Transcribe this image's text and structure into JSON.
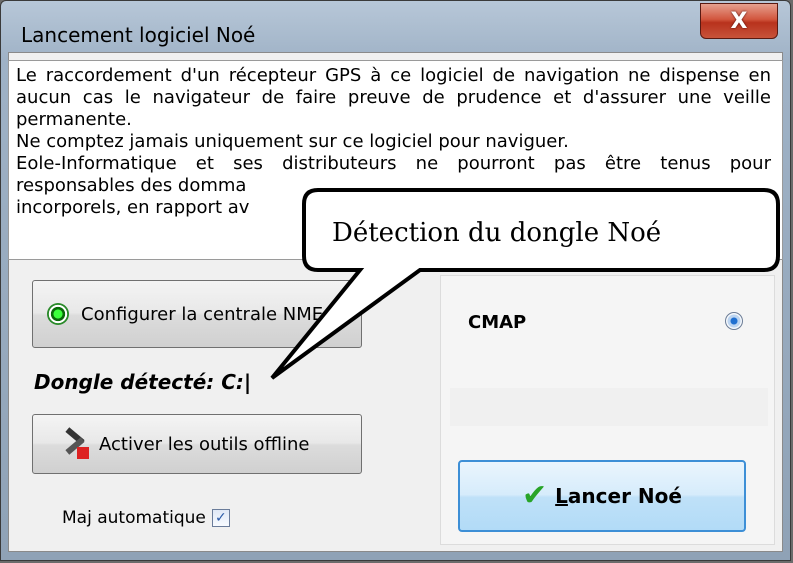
{
  "window": {
    "title": "Lancement logiciel Noé",
    "close_label": "X"
  },
  "notice": {
    "lines": [
      "Le raccordement d'un récepteur GPS à ce logiciel de navigation ne dispense en aucun cas le navigateur de faire preuve de prudence et d'assurer une veille permanente.",
      "Ne comptez jamais uniquement sur ce logiciel pour naviguer.",
      "Eole-Informatique et ses distributeurs ne pourront pas être tenus pour responsables des domma",
      "incorporels, en rapport av"
    ]
  },
  "left": {
    "config_button": "Configurer la centrale NME",
    "dongle_label": "Dongle détecté: C:|",
    "activer_button": "Activer les outils offline",
    "majauto_label": "Maj automatique",
    "majauto_checked": true
  },
  "right": {
    "cmap_label": "CMAP",
    "cmap_selected": true,
    "lancer_prefix": "L",
    "lancer_rest": "ancer Noé"
  },
  "callout": {
    "text": "Détection du dongle Noé"
  },
  "icons": {
    "config": "radio-target-icon",
    "activer": "tools-icon",
    "lancer": "checkmark-icon",
    "close": "close-icon"
  },
  "colors": {
    "close_red": "#c8533a",
    "lancer_border": "#3d8fd6",
    "check_green": "#28a428"
  }
}
